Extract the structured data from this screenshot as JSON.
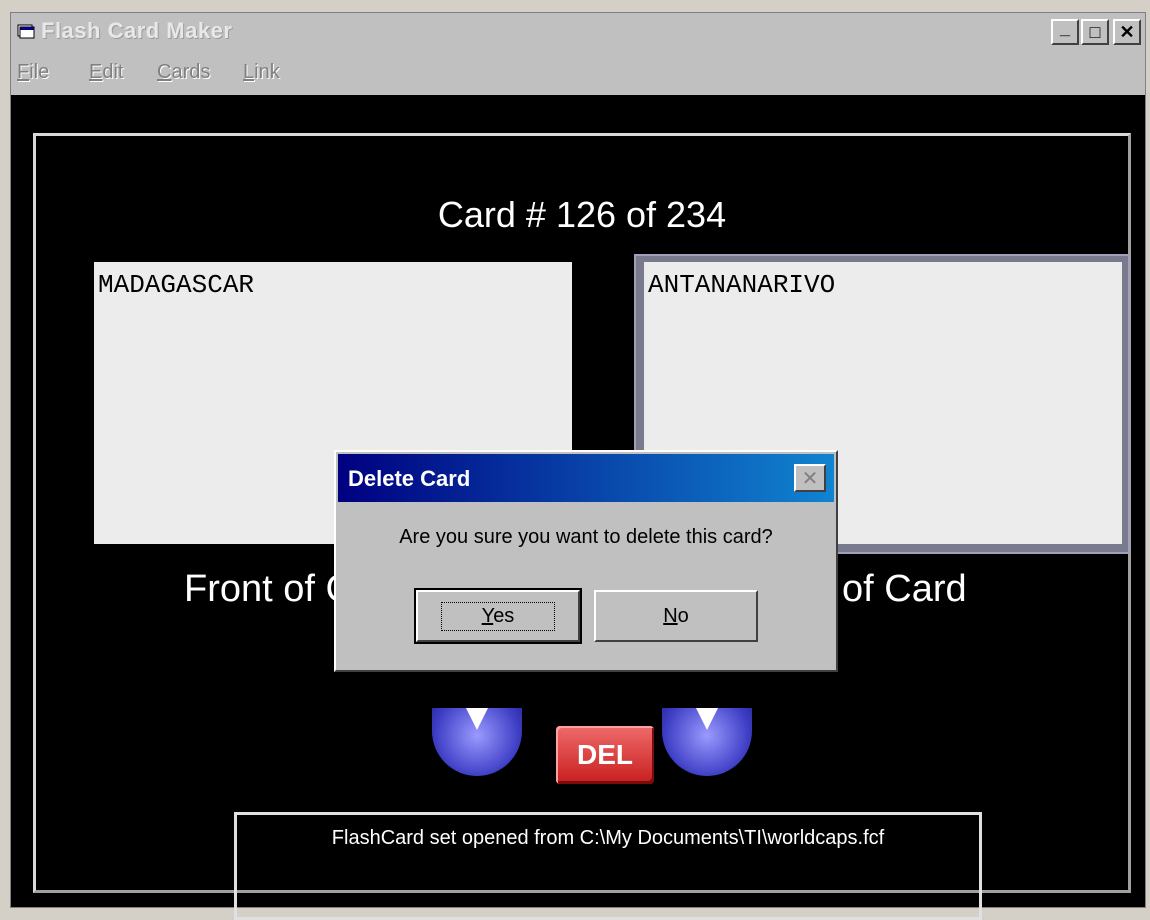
{
  "window": {
    "title": "Flash Card Maker",
    "controls": {
      "minimize": "_",
      "maximize": "□",
      "close": "✕"
    }
  },
  "menu": {
    "items": [
      {
        "label": "File",
        "mnemonic": "F",
        "rest": "ile"
      },
      {
        "label": "Edit",
        "mnemonic": "E",
        "rest": "dit"
      },
      {
        "label": "Cards",
        "mnemonic": "C",
        "rest": "ards"
      },
      {
        "label": "Link",
        "mnemonic": "L",
        "rest": "ink"
      }
    ]
  },
  "card": {
    "counter": "Card # 126 of 234",
    "front_text": "MADAGASCAR",
    "back_text": "ANTANANARIVO",
    "front_label": "Front of C",
    "back_label": "of Card"
  },
  "controls": {
    "delete_label": "DEL"
  },
  "status": {
    "message": "FlashCard set opened from C:\\My Documents\\TI\\worldcaps.fcf"
  },
  "dialog": {
    "title": "Delete Card",
    "message": "Are you sure you want to delete this card?",
    "yes_mnemonic": "Y",
    "yes_rest": "es",
    "no_mnemonic": "N",
    "no_rest": "o",
    "close_glyph": "✕"
  },
  "colors": {
    "dialog_title_start": "#000080",
    "dialog_title_end": "#1084d0",
    "delete_button": "#c81e1e",
    "arrow_buttons": "#3c3cc4",
    "client_background": "#000000"
  }
}
